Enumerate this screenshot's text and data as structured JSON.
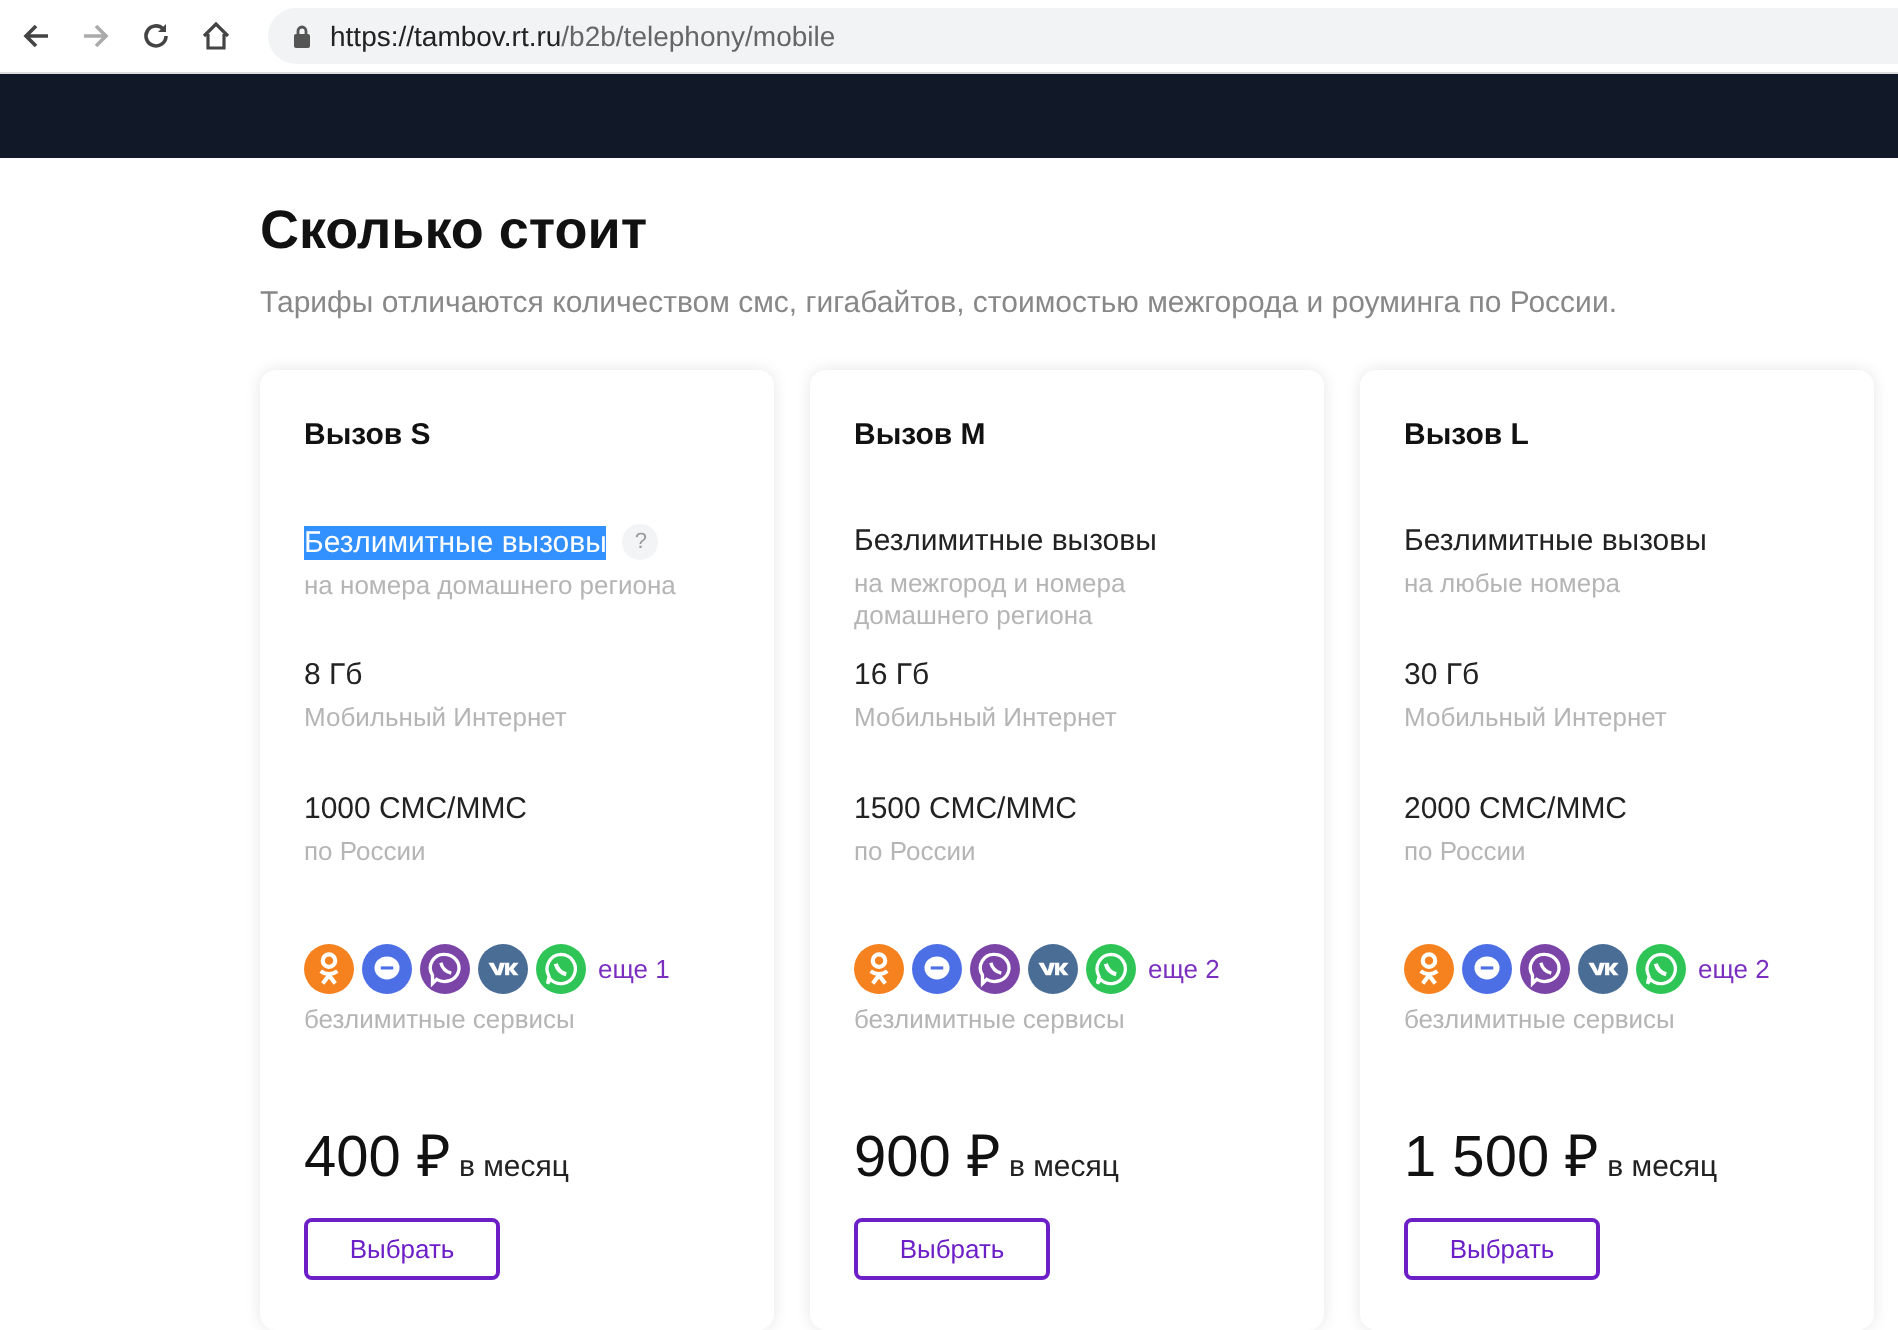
{
  "browser": {
    "url_host": "https://tambov.rt.ru",
    "url_path": "/b2b/telephony/mobile"
  },
  "section": {
    "title": "Сколько стоит",
    "subtitle": "Тарифы отличаются количеством смс, гигабайтов, стоимостью межгорода и роуминга по России."
  },
  "plans": [
    {
      "name": "Вызов S",
      "calls": {
        "label": "Безлимитные вызовы",
        "note": "на номера домашнего региона",
        "text_selected": true,
        "help": "?"
      },
      "data": {
        "label": "8 Гб",
        "note": "Мобильный Интернет"
      },
      "sms": {
        "label": "1000 СМС/ММС",
        "note": "по России"
      },
      "services": [
        {
          "kind": "figure",
          "color": "#f5821f"
        },
        {
          "kind": "chat",
          "color": "#4d6fe6"
        },
        {
          "kind": "phone",
          "color": "#7b45a8"
        },
        {
          "kind": "letters",
          "color": "#4a6d96"
        },
        {
          "kind": "handset",
          "color": "#2ec556"
        }
      ],
      "more": "еще 1",
      "services_note": "безлимитные сервисы",
      "price": "400 ₽",
      "period": "в месяц",
      "button": "Выбрать"
    },
    {
      "name": "Вызов M",
      "calls": {
        "label": "Безлимитные вызовы",
        "note": "на межгород и номера домашнего региона",
        "text_selected": false
      },
      "data": {
        "label": "16 Гб",
        "note": "Мобильный Интернет"
      },
      "sms": {
        "label": "1500 СМС/ММС",
        "note": "по России"
      },
      "services": [
        {
          "kind": "figure",
          "color": "#f5821f"
        },
        {
          "kind": "chat",
          "color": "#4d6fe6"
        },
        {
          "kind": "phone",
          "color": "#7b45a8"
        },
        {
          "kind": "letters",
          "color": "#4a6d96"
        },
        {
          "kind": "handset",
          "color": "#2ec556"
        }
      ],
      "more": "еще 2",
      "services_note": "безлимитные сервисы",
      "price": "900 ₽",
      "period": "в месяц",
      "button": "Выбрать"
    },
    {
      "name": "Вызов L",
      "calls": {
        "label": "Безлимитные вызовы",
        "note": "на любые номера",
        "text_selected": false
      },
      "data": {
        "label": "30 Гб",
        "note": "Мобильный Интернет"
      },
      "sms": {
        "label": "2000 СМС/ММС",
        "note": "по России"
      },
      "services": [
        {
          "kind": "figure",
          "color": "#f5821f"
        },
        {
          "kind": "chat",
          "color": "#4d6fe6"
        },
        {
          "kind": "phone",
          "color": "#7b45a8"
        },
        {
          "kind": "letters",
          "color": "#4a6d96"
        },
        {
          "kind": "handset",
          "color": "#2ec556"
        }
      ],
      "more": "еще 2",
      "services_note": "безлимитные сервисы",
      "price": "1 500 ₽",
      "period": "в месяц",
      "button": "Выбрать"
    }
  ]
}
